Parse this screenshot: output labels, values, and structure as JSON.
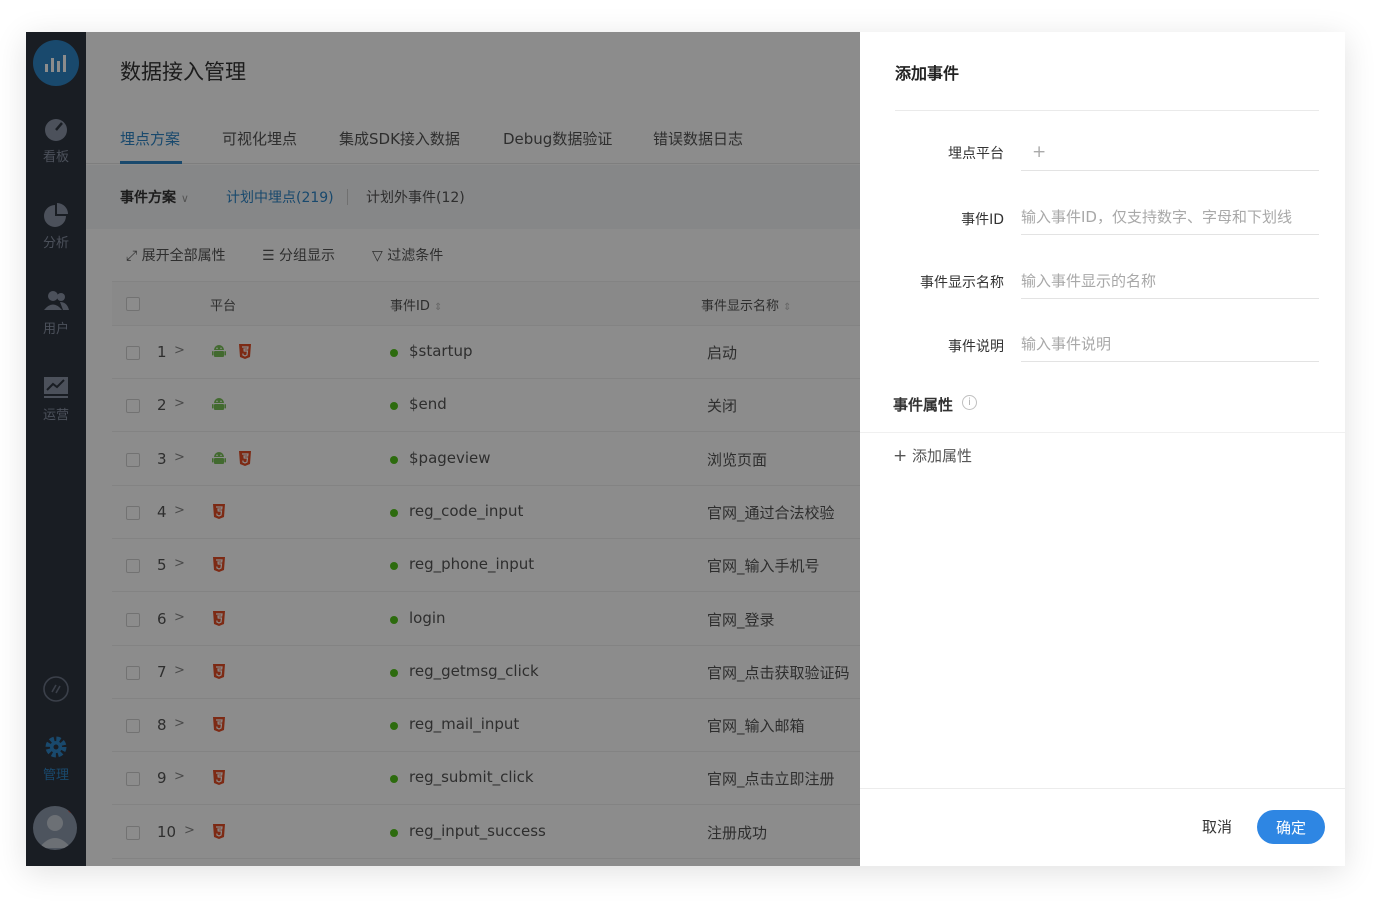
{
  "colors": {
    "accent": "#2e86c7",
    "sidebar": "#2f3541",
    "primary_button": "#2e86e3",
    "event_dot": "#52c41a",
    "html5": "#e44d26",
    "android": "#78c257"
  },
  "sidebar": {
    "items": [
      {
        "label": "看板",
        "icon": "gauge-icon"
      },
      {
        "label": "分析",
        "icon": "pie-chart-icon"
      },
      {
        "label": "用户",
        "icon": "users-icon"
      },
      {
        "label": "运营",
        "icon": "line-chart-icon"
      },
      {
        "label": "管理",
        "icon": "gear-icon"
      }
    ]
  },
  "page": {
    "title": "数据接入管理"
  },
  "tabs": [
    {
      "label": "埋点方案"
    },
    {
      "label": "可视化埋点"
    },
    {
      "label": "集成SDK接入数据"
    },
    {
      "label": "Debug数据验证"
    },
    {
      "label": "错误数据日志"
    }
  ],
  "subbar": {
    "scheme": "事件方案",
    "planned": "计划中埋点(219)",
    "unplanned": "计划外事件(12)"
  },
  "toolbar": {
    "expand": "展开全部属性",
    "group": "分组显示",
    "filter": "过滤条件"
  },
  "table": {
    "headers": {
      "platform": "平台",
      "event_id": "事件ID",
      "event_name": "事件显示名称"
    },
    "rows": [
      {
        "num": "1",
        "id": "$startup",
        "name": "启动",
        "android": true,
        "html5": true
      },
      {
        "num": "2",
        "id": "$end",
        "name": "关闭",
        "android": true,
        "html5": false
      },
      {
        "num": "3",
        "id": "$pageview",
        "name": "浏览页面",
        "android": true,
        "html5": true
      },
      {
        "num": "4",
        "id": "reg_code_input",
        "name": "官网_通过合法校验",
        "android": false,
        "html5": true
      },
      {
        "num": "5",
        "id": "reg_phone_input",
        "name": "官网_输入手机号",
        "android": false,
        "html5": true
      },
      {
        "num": "6",
        "id": "login",
        "name": "官网_登录",
        "android": false,
        "html5": true
      },
      {
        "num": "7",
        "id": "reg_getmsg_click",
        "name": "官网_点击获取验证码",
        "android": false,
        "html5": true
      },
      {
        "num": "8",
        "id": "reg_mail_input",
        "name": "官网_输入邮箱",
        "android": false,
        "html5": true
      },
      {
        "num": "9",
        "id": "reg_submit_click",
        "name": "官网_点击立即注册",
        "android": false,
        "html5": true
      },
      {
        "num": "10",
        "id": "reg_input_success",
        "name": "注册成功",
        "android": false,
        "html5": true
      }
    ]
  },
  "drawer": {
    "title": "添加事件",
    "platform_label": "埋点平台",
    "event_id_label": "事件ID",
    "event_id_placeholder": "输入事件ID，仅支持数字、字母和下划线",
    "display_name_label": "事件显示名称",
    "display_name_placeholder": "输入事件显示的名称",
    "desc_label": "事件说明",
    "desc_placeholder": "输入事件说明",
    "attrs_title": "事件属性",
    "add_attr": "添加属性",
    "cancel": "取消",
    "confirm": "确定"
  }
}
